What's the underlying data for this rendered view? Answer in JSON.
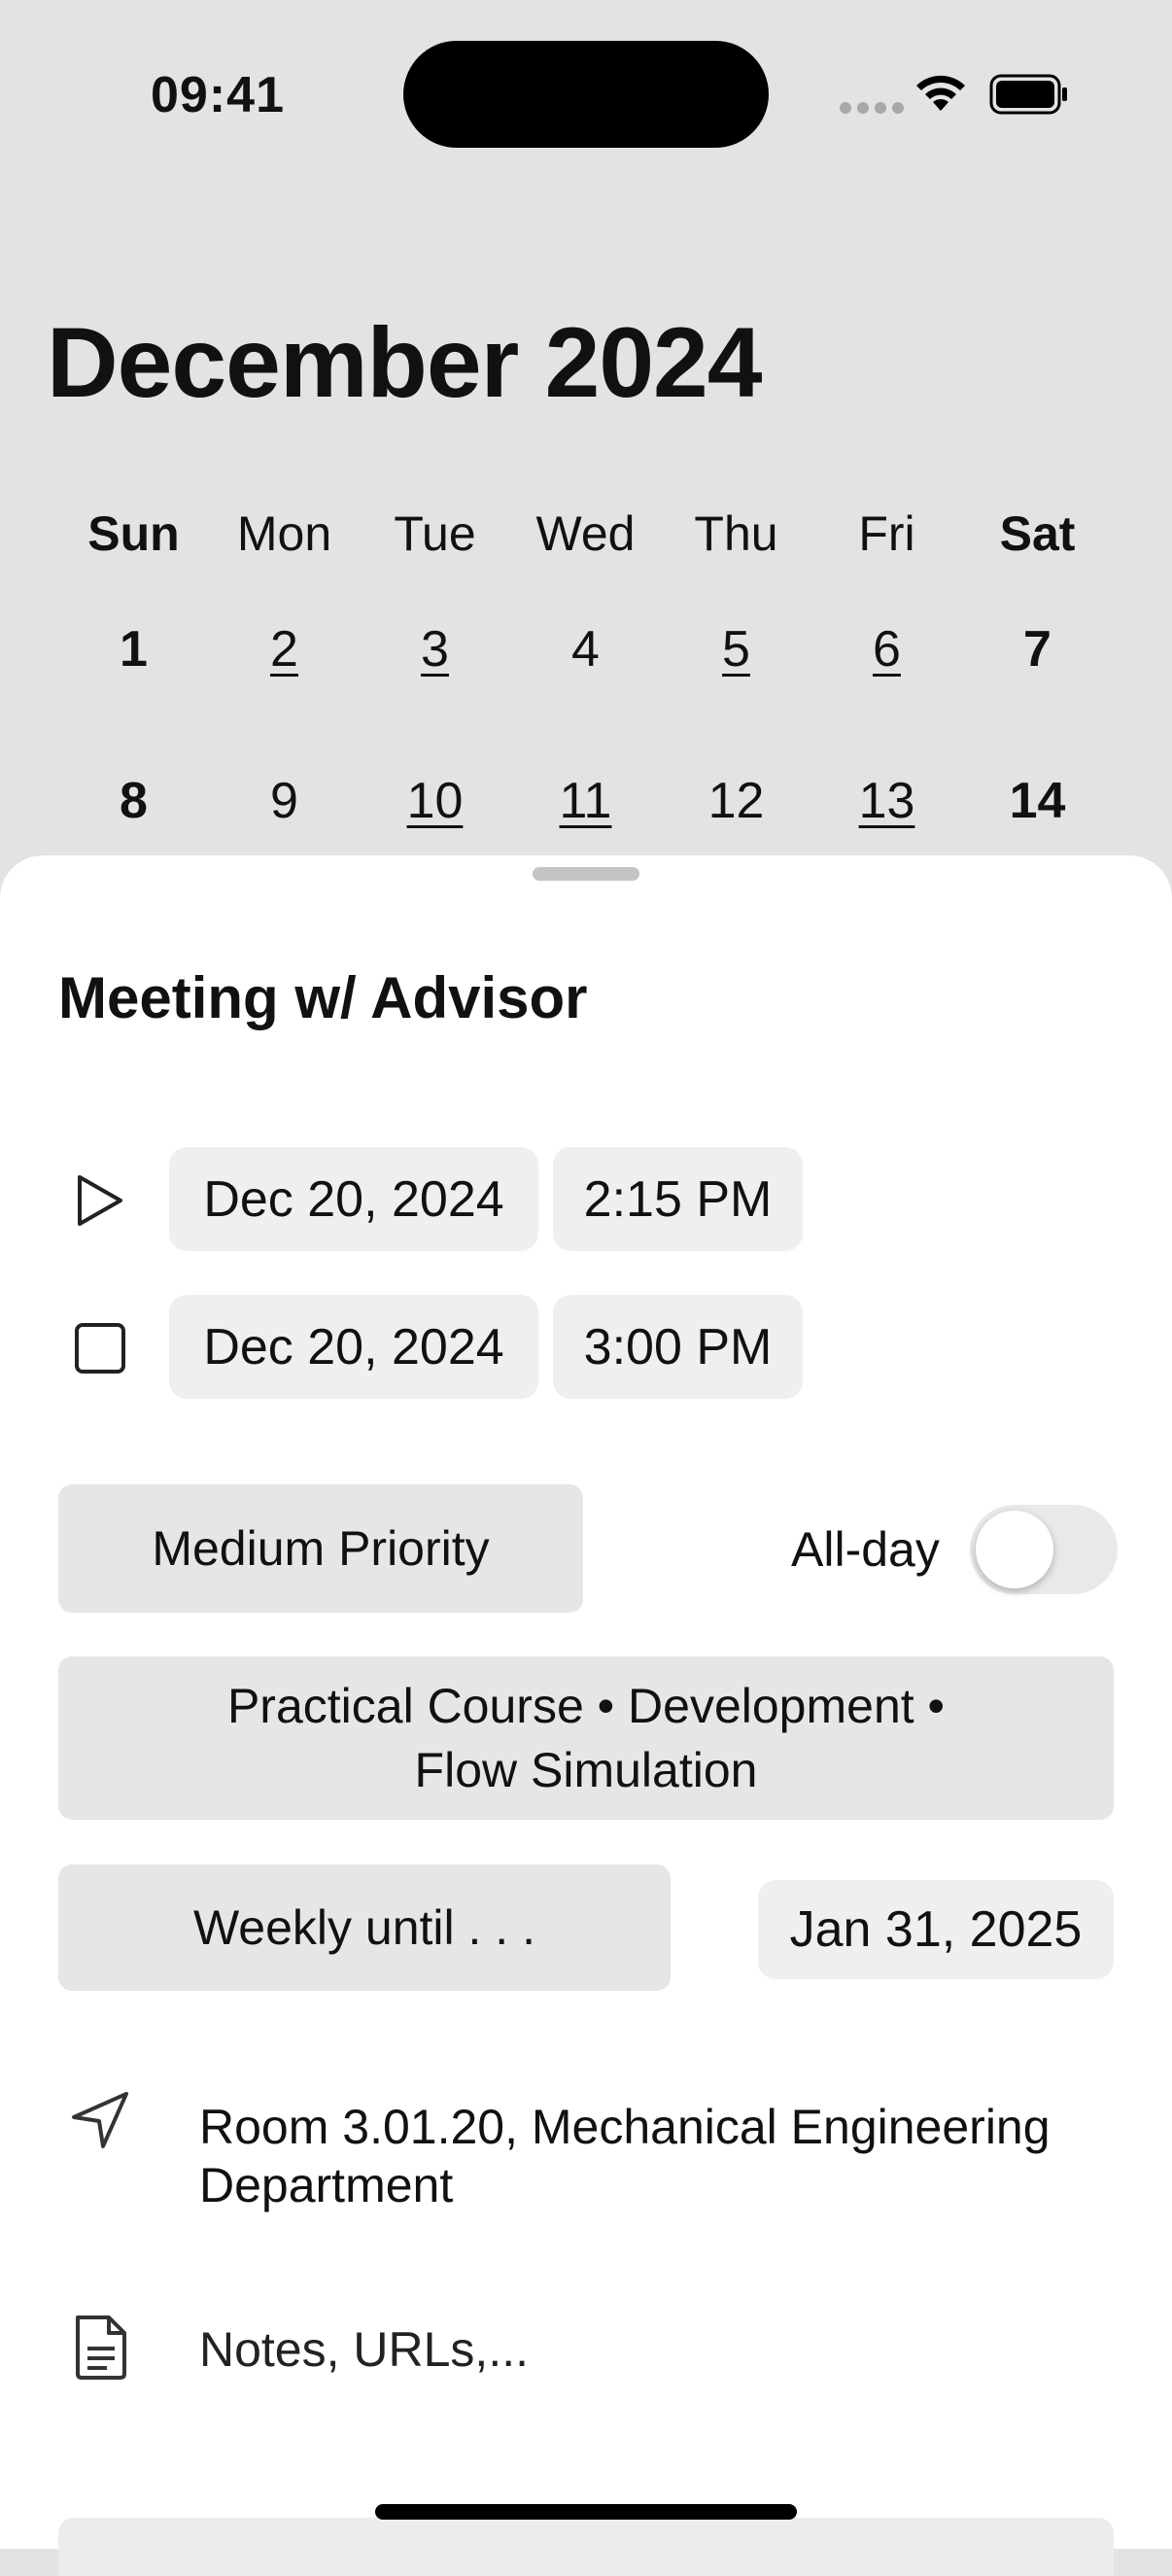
{
  "status_bar": {
    "time": "09:41"
  },
  "calendar": {
    "month_title": "December 2024",
    "weekdays": [
      "Sun",
      "Mon",
      "Tue",
      "Wed",
      "Thu",
      "Fri",
      "Sat"
    ],
    "week1": [
      "1",
      "2",
      "3",
      "4",
      "5",
      "6",
      "7"
    ],
    "week2": [
      "8",
      "9",
      "10",
      "11",
      "12",
      "13",
      "14"
    ]
  },
  "event": {
    "title": "Meeting w/ Advisor",
    "start_date": "Dec 20, 2024",
    "start_time": "2:15 PM",
    "end_date": "Dec 20, 2024",
    "end_time": "3:00 PM",
    "priority_label": "Medium Priority",
    "allday_label": "All-day",
    "allday_on": false,
    "categories_line1": "Practical Course • Development •",
    "categories_line2": "Flow Simulation",
    "repeat_label": "Weekly until . . .",
    "repeat_end_date": "Jan 31, 2025",
    "location_line1": "Room 3.01.20, Mechanical Engineering",
    "location_line2": "Department",
    "notes_placeholder": "Notes, URLs,..."
  },
  "icons": {
    "start": "play-icon",
    "end": "checkbox-icon",
    "location": "location-arrow-icon",
    "notes": "document-icon"
  }
}
